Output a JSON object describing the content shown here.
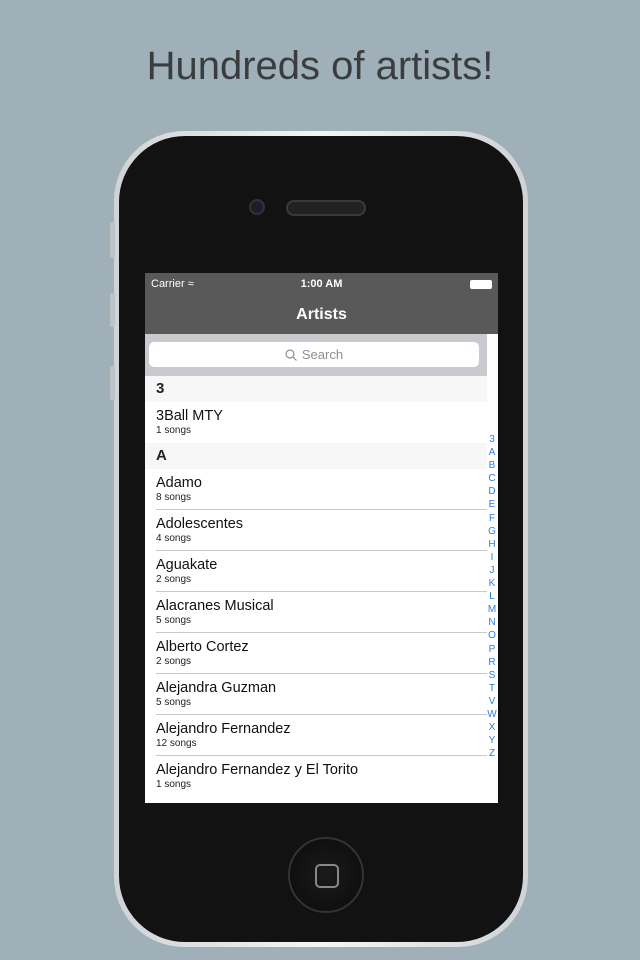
{
  "headline": "Hundreds of artists!",
  "status": {
    "carrier": "Carrier",
    "time": "1:00 AM"
  },
  "nav": {
    "title": "Artists"
  },
  "search": {
    "placeholder": "Search"
  },
  "sections": [
    {
      "header": "3",
      "rows": [
        {
          "name": "3Ball MTY",
          "songs": "1 songs"
        }
      ]
    },
    {
      "header": "A",
      "rows": [
        {
          "name": "Adamo",
          "songs": "8 songs"
        },
        {
          "name": "Adolescentes",
          "songs": "4 songs"
        },
        {
          "name": "Aguakate",
          "songs": "2 songs"
        },
        {
          "name": "Alacranes Musical",
          "songs": "5 songs"
        },
        {
          "name": "Alberto Cortez",
          "songs": "2 songs"
        },
        {
          "name": "Alejandra Guzman",
          "songs": "5 songs"
        },
        {
          "name": "Alejandro Fernandez",
          "songs": "12 songs"
        },
        {
          "name": "Alejandro Fernandez y El Torito",
          "songs": "1 songs"
        }
      ]
    }
  ],
  "index": [
    "3",
    "A",
    "B",
    "C",
    "D",
    "E",
    "F",
    "G",
    "H",
    "I",
    "J",
    "K",
    "L",
    "M",
    "N",
    "O",
    "P",
    "R",
    "S",
    "T",
    "V",
    "W",
    "X",
    "Y",
    "Z"
  ],
  "colors": {
    "background": "#9fb0b8",
    "nav": "#595959",
    "index": "#2f7ee0"
  }
}
